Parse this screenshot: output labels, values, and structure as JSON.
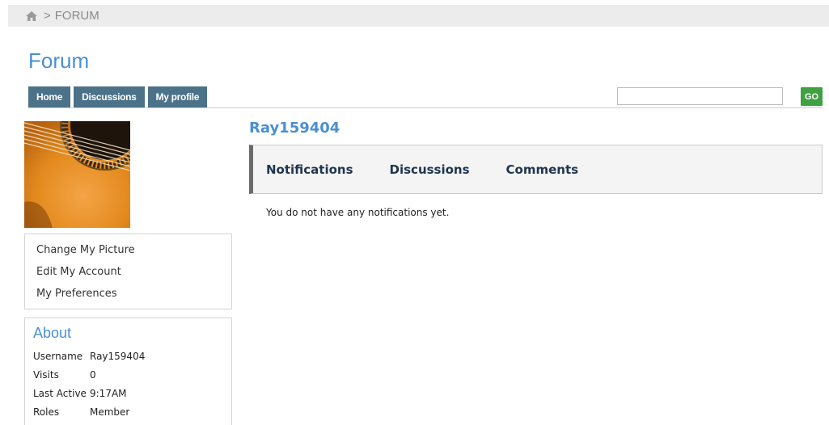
{
  "breadcrumb": {
    "separator": ">",
    "current": "FORUM"
  },
  "page_title": "Forum",
  "nav": {
    "home": "Home",
    "discussions": "Discussions",
    "my_profile": "My profile"
  },
  "search": {
    "value": "",
    "go_label": "GO"
  },
  "profile": {
    "name": "Ray159404"
  },
  "account_menu": {
    "change_picture": "Change My Picture",
    "edit_account": "Edit My Account",
    "preferences": "My Preferences"
  },
  "about": {
    "title": "About",
    "rows": [
      {
        "key": "Username",
        "value": "Ray159404"
      },
      {
        "key": "Visits",
        "value": "0"
      },
      {
        "key": "Last Active",
        "value": "9:17AM"
      },
      {
        "key": "Roles",
        "value": "Member"
      }
    ]
  },
  "tabs": {
    "notifications": "Notifications",
    "discussions": "Discussions",
    "comments": "Comments"
  },
  "notifications": {
    "empty_message": "You do not have any notifications yet."
  },
  "colors": {
    "accent": "#4a8fd3",
    "nav_bg": "#4b7289",
    "go_button": "#3fa140"
  }
}
